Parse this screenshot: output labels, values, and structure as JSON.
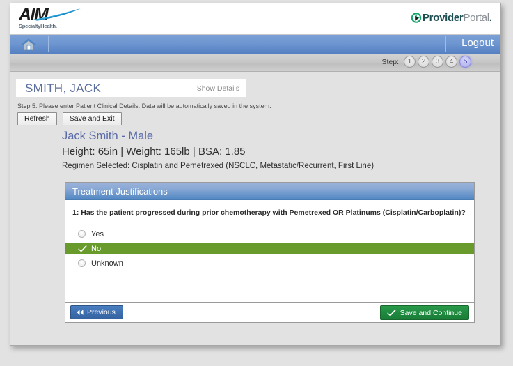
{
  "header": {
    "logo": {
      "wordmark": "AIM",
      "subtitle": "SpecialtyHealth.",
      "icon": "aim-swoosh-logo"
    },
    "portal_brand": {
      "icon": "provider-portal-icon",
      "part1": "Provider",
      "part2": "Portal",
      "dot": "."
    }
  },
  "nav": {
    "home_icon": "home-icon",
    "logout_label": "Logout"
  },
  "steps": {
    "label": "Step:",
    "items": [
      "1",
      "2",
      "3",
      "4",
      "5"
    ],
    "active": "5",
    "active_color": "#a2a2e8"
  },
  "patient_bar": {
    "name": "SMITH, JACK",
    "show_details_label": "Show Details"
  },
  "instruction": "Step 5: Please enter Patient Clinical Details. Data will be automatically saved in the system.",
  "actions": {
    "refresh_label": "Refresh",
    "save_exit_label": "Save and Exit"
  },
  "patient_summary": {
    "name_gender": "Jack Smith - Male",
    "vitals": "Height: 65in  |  Weight: 165lb  |  BSA: 1.85",
    "regimen": "Regimen Selected: Cisplatin and Pemetrexed (NSCLC, Metastatic/Recurrent, First Line)"
  },
  "justifications_panel": {
    "title": "Treatment Justifications",
    "question": "1: Has the patient progressed during prior chemotherapy with Pemetrexed OR Platinums (Cisplatin/Carboplatin)?",
    "options": [
      {
        "label": "Yes",
        "selected": false
      },
      {
        "label": "No",
        "selected": true
      },
      {
        "label": "Unknown",
        "selected": false
      }
    ],
    "selected_color": "#689a2c",
    "header_color": "#5188c4"
  },
  "footer": {
    "previous_label": "Previous",
    "previous_icon": "double-left-arrow-icon",
    "save_continue_label": "Save and Continue",
    "save_continue_icon": "check-icon",
    "save_continue_color": "#1f8a3f"
  }
}
